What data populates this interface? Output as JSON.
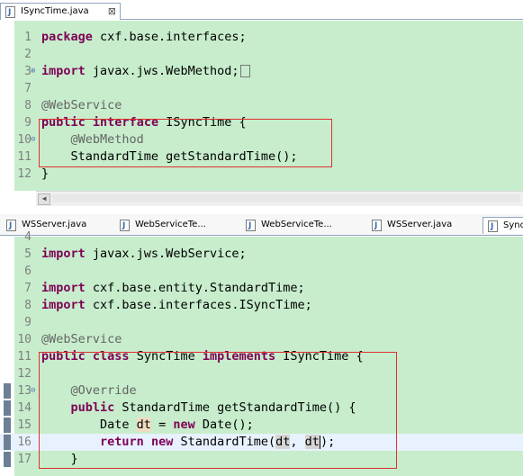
{
  "top_pane": {
    "tab": {
      "label": "ISyncTime.java",
      "close": "⊠"
    },
    "lines": [
      {
        "num": "1",
        "tokens": [
          [
            "kw",
            "package"
          ],
          [
            "t",
            " cxf.base.interfaces;"
          ]
        ]
      },
      {
        "num": "2",
        "tokens": []
      },
      {
        "num": "3",
        "tokens": [
          [
            "kw",
            "import"
          ],
          [
            "t",
            " javax.jws.WebMethod;"
          ]
        ],
        "fold": "+",
        "collapsed": true
      },
      {
        "num": "7",
        "tokens": []
      },
      {
        "num": "8",
        "tokens": [
          [
            "ann",
            "@WebService"
          ]
        ]
      },
      {
        "num": "9",
        "tokens": [
          [
            "kw",
            "public"
          ],
          [
            "t",
            " "
          ],
          [
            "kw",
            "interface"
          ],
          [
            "t",
            " ISyncTime {"
          ]
        ]
      },
      {
        "num": "10",
        "tokens": [
          [
            "t",
            "    "
          ],
          [
            "ann",
            "@WebMethod"
          ]
        ],
        "fold": "−"
      },
      {
        "num": "11",
        "tokens": [
          [
            "t",
            "    StandardTime getStandardTime();"
          ]
        ]
      },
      {
        "num": "12",
        "tokens": [
          [
            "t",
            "}"
          ]
        ]
      }
    ]
  },
  "bottom_pane": {
    "tabs": [
      {
        "label": "WSServer.java"
      },
      {
        "label": "WebServiceTe..."
      },
      {
        "label": "WebServiceTe..."
      },
      {
        "label": "WSServer.java"
      },
      {
        "label": "Sync"
      }
    ],
    "lines": [
      {
        "num": "4",
        "tokens": []
      },
      {
        "num": "5",
        "tokens": [
          [
            "kw",
            "import"
          ],
          [
            "t",
            " javax.jws.WebService;"
          ]
        ]
      },
      {
        "num": "6",
        "tokens": []
      },
      {
        "num": "7",
        "tokens": [
          [
            "kw",
            "import"
          ],
          [
            "t",
            " cxf.base.entity.StandardTime;"
          ]
        ]
      },
      {
        "num": "8",
        "tokens": [
          [
            "kw",
            "import"
          ],
          [
            "t",
            " cxf.base.interfaces.ISyncTime;"
          ]
        ]
      },
      {
        "num": "9",
        "tokens": []
      },
      {
        "num": "10",
        "tokens": [
          [
            "ann",
            "@WebService"
          ]
        ]
      },
      {
        "num": "11",
        "tokens": [
          [
            "kw",
            "public"
          ],
          [
            "t",
            " "
          ],
          [
            "kw",
            "class"
          ],
          [
            "t",
            " SyncTime "
          ],
          [
            "kw",
            "implements"
          ],
          [
            "t",
            " ISyncTime {"
          ]
        ]
      },
      {
        "num": "12",
        "tokens": []
      },
      {
        "num": "13",
        "tokens": [
          [
            "t",
            "    "
          ],
          [
            "ann",
            "@Override"
          ]
        ],
        "fold": "−",
        "mark": true
      },
      {
        "num": "14",
        "tokens": [
          [
            "t",
            "    "
          ],
          [
            "kw",
            "public"
          ],
          [
            "t",
            " StandardTime getStandardTime() {"
          ]
        ],
        "mark": true,
        "arrow": true
      },
      {
        "num": "15",
        "tokens": [
          [
            "t",
            "        Date "
          ],
          [
            "var",
            "dt"
          ],
          [
            "t",
            " = "
          ],
          [
            "kw",
            "new"
          ],
          [
            "t",
            " Date();"
          ]
        ],
        "mark": true
      },
      {
        "num": "16",
        "tokens": [
          [
            "t",
            "        "
          ],
          [
            "kw",
            "return"
          ],
          [
            "t",
            " "
          ],
          [
            "kw",
            "new"
          ],
          [
            "t",
            " StandardTime("
          ],
          [
            "dtv",
            "dt"
          ],
          [
            "t",
            ", "
          ],
          [
            "dtv",
            "dt"
          ],
          [
            "caret",
            ""
          ],
          [
            "t",
            ");"
          ]
        ],
        "mark": true,
        "current": true
      },
      {
        "num": "17",
        "tokens": [
          [
            "t",
            "    }"
          ]
        ],
        "mark": true
      }
    ]
  }
}
